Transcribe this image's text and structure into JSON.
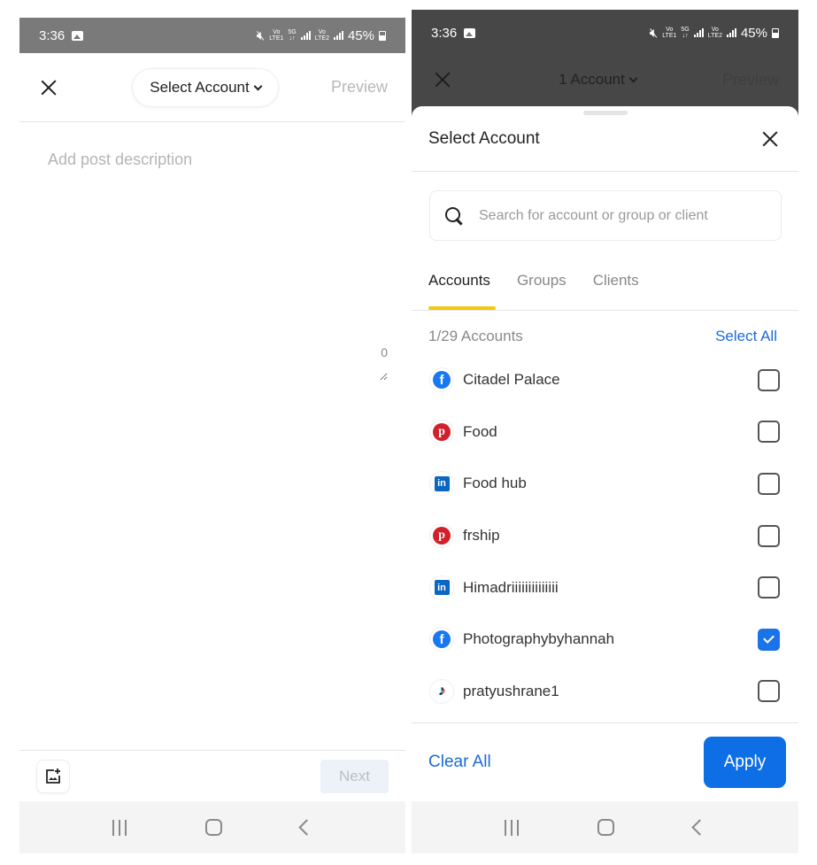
{
  "status_bar": {
    "time": "3:36",
    "battery": "45%",
    "network_labels": [
      "VoLTE1",
      "5G",
      "VoLTE2"
    ]
  },
  "left_screen": {
    "close_icon": "close-icon",
    "account_selector_label": "Select Account",
    "preview_label": "Preview",
    "description_placeholder": "Add post description",
    "description_value": "",
    "char_count": "0",
    "add_media_icon": "add-image-icon",
    "next_label": "Next"
  },
  "right_screen": {
    "background_account_selector_label": "1 Account",
    "background_preview_label": "Preview",
    "sheet": {
      "title": "Select Account",
      "search_placeholder": "Search for account or group or client",
      "search_value": "",
      "tabs": [
        {
          "label": "Accounts",
          "active": true
        },
        {
          "label": "Groups",
          "active": false
        },
        {
          "label": "Clients",
          "active": false
        }
      ],
      "count_label": "1/29 Accounts",
      "select_all_label": "Select All",
      "accounts": [
        {
          "name": "Citadel Palace",
          "network": "facebook",
          "checked": false
        },
        {
          "name": "Food",
          "network": "pinterest",
          "checked": false
        },
        {
          "name": "Food hub",
          "network": "linkedin",
          "checked": false
        },
        {
          "name": "frship",
          "network": "pinterest",
          "checked": false
        },
        {
          "name": "Himadriiiiiiiiiiiiii",
          "network": "linkedin",
          "checked": false
        },
        {
          "name": "Photographybyhannah",
          "network": "facebook",
          "checked": true
        },
        {
          "name": "pratyushrane1",
          "network": "tiktok",
          "checked": false
        }
      ],
      "clear_all_label": "Clear All",
      "apply_label": "Apply"
    }
  },
  "colors": {
    "accent_blue": "#1a6bd6",
    "apply_button": "#0d6ee6",
    "checkbox_checked": "#1a73e8",
    "tab_indicator": "#f2c811",
    "facebook": "#1877f2",
    "pinterest": "#d1202a",
    "linkedin": "#0a66c2"
  }
}
